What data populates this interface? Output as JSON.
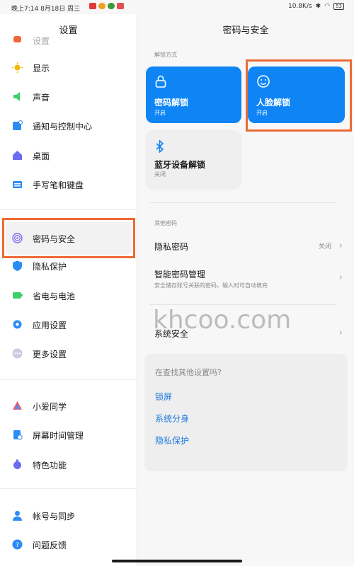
{
  "status_bar": {
    "time": "晚上7:14",
    "date": "8月18日",
    "weekday": "周三",
    "network_speed": "10.8K/s",
    "battery": "53"
  },
  "left_pane": {
    "title": "设置",
    "items": [
      {
        "label": "设置",
        "icon": "orange-icon",
        "color": "#f0653a"
      },
      {
        "label": "显示",
        "icon": "sun-icon",
        "color": "#f5b800"
      },
      {
        "label": "声音",
        "icon": "speaker-icon",
        "color": "#3ccf6a"
      },
      {
        "label": "通知与控制中心",
        "icon": "notification-icon",
        "color": "#2b8cf4"
      },
      {
        "label": "桌面",
        "icon": "home-icon",
        "color": "#6b6cf0"
      },
      {
        "label": "手写笔和键盘",
        "icon": "keyboard-icon",
        "color": "#2b8cf4"
      },
      {
        "label": "密码与安全",
        "icon": "fingerprint-icon",
        "color": "#7b6cf2"
      },
      {
        "label": "隐私保护",
        "icon": "shield-icon",
        "color": "#2b8cf4"
      },
      {
        "label": "省电与电池",
        "icon": "battery-icon",
        "color": "#3ccf6a"
      },
      {
        "label": "应用设置",
        "icon": "gear-icon",
        "color": "#2b8cf4"
      },
      {
        "label": "更多设置",
        "icon": "more-icon",
        "color": "#8b8fb0"
      },
      {
        "label": "小爱同学",
        "icon": "assistant-icon",
        "color": "#ee5a6a"
      },
      {
        "label": "屏幕时间管理",
        "icon": "screen-time-icon",
        "color": "#2b8cf4"
      },
      {
        "label": "特色功能",
        "icon": "feature-icon",
        "color": "#6b6cf0"
      },
      {
        "label": "帐号与同步",
        "icon": "account-icon",
        "color": "#2b8cf4"
      },
      {
        "label": "问题反馈",
        "icon": "feedback-icon",
        "color": "#2b8cf4"
      }
    ]
  },
  "right_pane": {
    "title": "密码与安全",
    "unlock_caption": "解锁方式",
    "cards": [
      {
        "title": "密码解锁",
        "status": "开启",
        "icon": "lock-icon"
      },
      {
        "title": "人脸解锁",
        "status": "开启",
        "icon": "face-icon"
      },
      {
        "title": "蓝牙设备解锁",
        "status": "关闭",
        "icon": "bluetooth-icon"
      }
    ],
    "other_caption": "其他密码",
    "rows": [
      {
        "title": "隐私密码",
        "value": "关闭",
        "subtitle": ""
      },
      {
        "title": "智能密码管理",
        "value": "",
        "subtitle": "安全储存账号关联的密码，输入时可自动填充"
      },
      {
        "title": "系统安全",
        "value": "",
        "subtitle": ""
      }
    ],
    "suggest": {
      "question": "在查找其他设置吗?",
      "links": [
        "锁屏",
        "系统分身",
        "隐私保护"
      ]
    }
  },
  "watermark": "khcoo.com",
  "colors": {
    "accent": "#0f85f5",
    "highlight": "#ec6a35",
    "link": "#1b78e0"
  }
}
